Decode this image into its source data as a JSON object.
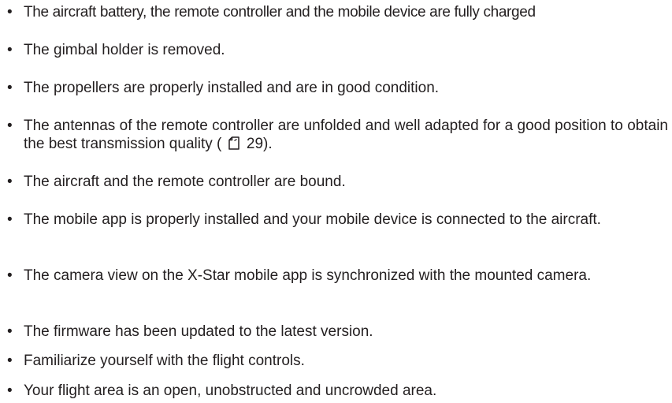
{
  "checklist": {
    "items": [
      {
        "text": "The aircraft battery, the remote controller and the mobile device are fully charged"
      },
      {
        "text": "The gimbal holder is removed."
      },
      {
        "text": "The propellers are properly installed and are in good condition."
      },
      {
        "text_before": "The antennas of the remote controller are unfolded and well adapted for a good position to obtain the best transmission quality (",
        "page_ref": "29).",
        "icon": "page-reference-icon"
      },
      {
        "text": "The aircraft and the remote controller are bound."
      },
      {
        "text": "The mobile app is properly installed and your mobile device is connected to the aircraft."
      },
      {
        "text": "The camera view on the X-Star mobile app is synchronized with the mounted camera."
      },
      {
        "text": "The firmware has been updated to the latest version."
      },
      {
        "text": "Familiarize yourself with the flight controls."
      },
      {
        "text": "Your flight area is an open, unobstructed and uncrowded area."
      }
    ]
  }
}
